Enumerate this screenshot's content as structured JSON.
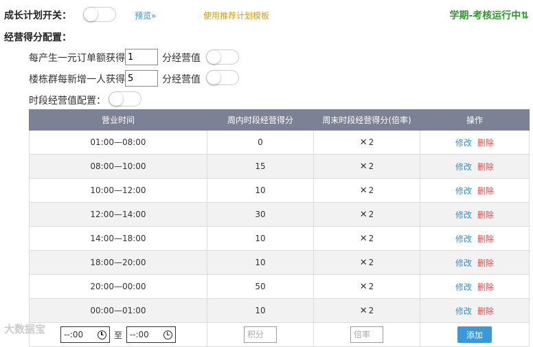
{
  "header": {
    "growth_plan_label": "成长计划开关：",
    "preview_link": "预览»",
    "template_link": "使用推荐计划模板",
    "run_status": "学期-考核运行中⇅"
  },
  "config": {
    "section_title": "经营得分配置：",
    "order_prefix": "每产生一元订单额获得",
    "order_value": "1",
    "order_suffix": "分经营值",
    "member_prefix": "楼栋群每新增一人获得",
    "member_value": "5",
    "member_suffix": "分经营值",
    "period_label": "时段经营值配置："
  },
  "table": {
    "headers": [
      "营业时间",
      "周内时段经营得分",
      "周末时段经营得分(倍率)",
      "操作"
    ],
    "edit_label": "修改",
    "delete_label": "删除",
    "rows": [
      {
        "time": "01:00—08:00",
        "weekday": "0",
        "weekend": "2"
      },
      {
        "time": "08:00—10:00",
        "weekday": "15",
        "weekend": "2"
      },
      {
        "time": "10:00—12:00",
        "weekday": "10",
        "weekend": "2"
      },
      {
        "time": "12:00—14:00",
        "weekday": "30",
        "weekend": "2"
      },
      {
        "time": "14:00—18:00",
        "weekday": "10",
        "weekend": "2"
      },
      {
        "time": "18:00—20:00",
        "weekday": "10",
        "weekend": "2"
      },
      {
        "time": "20:00—00:00",
        "weekday": "50",
        "weekend": "2"
      },
      {
        "time": "00:00—01:00",
        "weekday": "10",
        "weekend": "2"
      }
    ]
  },
  "form": {
    "start_time": "--:00",
    "to_label": "至",
    "end_time": "--:00",
    "score_placeholder": "积分",
    "rate_placeholder": "倍率",
    "add_label": "添加"
  },
  "icons": {
    "multiply": "✕",
    "clock": "clock-icon"
  },
  "watermark": "大数据宝"
}
